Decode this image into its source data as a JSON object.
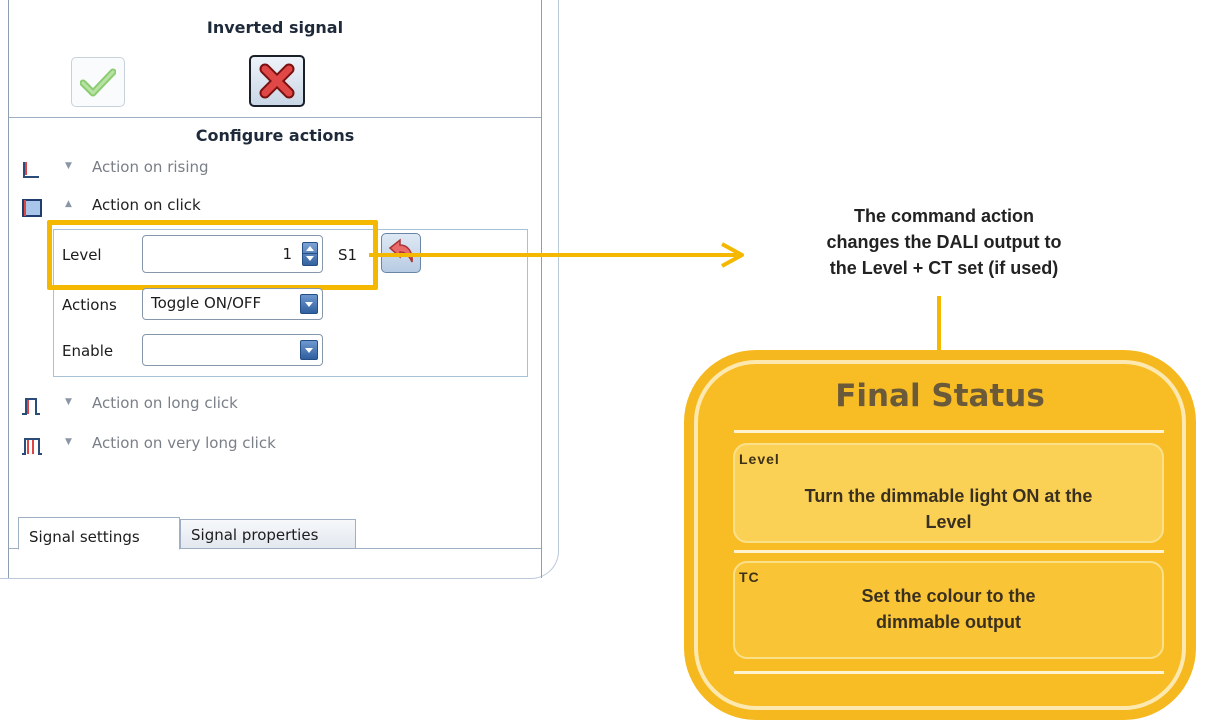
{
  "panel": {
    "inverted_signal_title": "Inverted signal",
    "configure_actions_title": "Configure actions",
    "actions": [
      {
        "label": "Action on rising",
        "expanded": false
      },
      {
        "label": "Action on click",
        "expanded": true
      },
      {
        "label": "Action on long click",
        "expanded": false
      },
      {
        "label": "Action on very long click",
        "expanded": false
      }
    ],
    "level": {
      "label": "Level",
      "value": "1",
      "suffix": "S1"
    },
    "actions_field": {
      "label": "Actions",
      "value": "Toggle ON/OFF"
    },
    "enable_field": {
      "label": "Enable",
      "value": ""
    },
    "tabs": [
      "Signal settings",
      "Signal properties"
    ],
    "active_tab": "Signal settings"
  },
  "callout": {
    "lines": [
      "The command action",
      "changes the DALI output to",
      "the Level + CT set (if used)"
    ]
  },
  "final_status": {
    "title": "Final Status",
    "sections": [
      {
        "tag": "Level",
        "text_lines": [
          "Turn the dimmable light ON at the",
          "Level"
        ]
      },
      {
        "tag": "TC",
        "text_lines": [
          "Set the colour to the",
          "dimmable output"
        ]
      }
    ]
  },
  "colors": {
    "highlight": "#f5b800",
    "card": "#f5b81f",
    "accent_blue": "#2f5f9f"
  }
}
